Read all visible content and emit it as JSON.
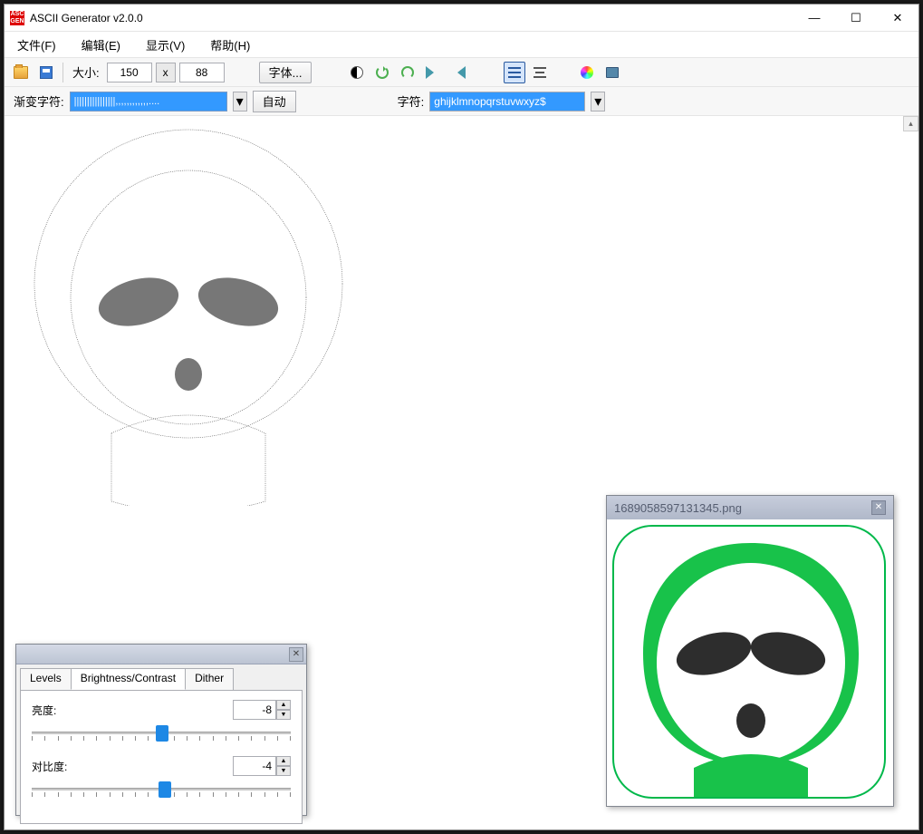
{
  "window": {
    "title": "ASCII Generator v2.0.0"
  },
  "menus": {
    "file": "文件(F)",
    "edit": "编辑(E)",
    "view": "显示(V)",
    "help": "帮助(H)"
  },
  "toolbar": {
    "size_label": "大小:",
    "width": "150",
    "sep_x": "x",
    "height": "88",
    "font_btn": "字体...",
    "toolbar2": {
      "gradient_label": "渐变字符:",
      "gradient_value": "||||||||||||||||,,,,,,,,,,,,....",
      "auto_btn": "自动",
      "char_label": "字符:",
      "char_value": "ghijklmnopqrstuvwxyz$"
    }
  },
  "bc_panel": {
    "tab_levels": "Levels",
    "tab_bc": "Brightness/Contrast",
    "tab_dither": "Dither",
    "brightness_label": "亮度:",
    "brightness_value": "-8",
    "contrast_label": "对比度:",
    "contrast_value": "-4"
  },
  "preview_panel": {
    "filename": "1689058597131345.png"
  }
}
